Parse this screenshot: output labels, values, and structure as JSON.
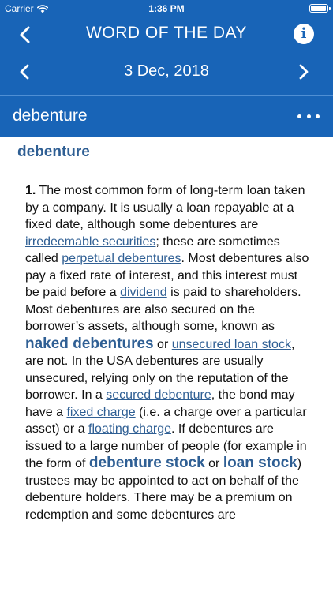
{
  "status_bar": {
    "carrier": "Carrier",
    "time": "1:36 PM",
    "wifi_icon": "wifi-icon",
    "battery_icon": "battery-icon"
  },
  "nav": {
    "title": "WORD OF THE DAY",
    "back_icon": "chevron-left-icon",
    "info_icon": "info-icon",
    "info_glyph": "i"
  },
  "date_nav": {
    "date": "3 Dec, 2018",
    "prev_icon": "chevron-left-icon",
    "next_icon": "chevron-right-icon"
  },
  "entry_bar": {
    "word": "debenture",
    "more_icon": "ellipsis-icon"
  },
  "entry": {
    "headword": "debenture",
    "sense_number": "1.",
    "text": {
      "t1": " The most common form of long-term loan taken by a company. It is usually a loan repayable at a fixed date, although some debentures are ",
      "t2": "; these are sometimes called ",
      "t3": ". Most debentures also pay a fixed rate of interest, and this interest must be paid before a ",
      "t4": " is paid to shareholders. Most debentures are also secured on the borrower’s assets, although some, known as ",
      "t5": " or ",
      "t6": ", are not. In the USA debentures are usually unsecured, relying only on the reputation of the borrower. In a ",
      "t7": ", the bond may have a ",
      "t8": " (i.e. a charge over a particular asset) or a ",
      "t9": ". If debentures are issued to a large number of people (for example in the form of ",
      "t10": " or ",
      "t11": ") trustees may be appointed to act on behalf of the debenture holders. There may be a premium on redemption and some debentures are"
    },
    "links": {
      "irredeemable_securities": "irredeemable securities",
      "perpetual_debentures": "perpetual debentures",
      "dividend": "dividend",
      "naked_debentures": "naked debentures",
      "unsecured_loan_stock": "unsecured loan stock",
      "secured_debenture": "secured debenture",
      "fixed_charge": "fixed charge",
      "floating_charge": "floating charge",
      "debenture_stock": "debenture stock",
      "loan_stock": "loan stock"
    }
  },
  "colors": {
    "header_blue": "#1864b7",
    "link_blue": "#2f5f94",
    "text": "#111111",
    "background": "#ffffff"
  }
}
